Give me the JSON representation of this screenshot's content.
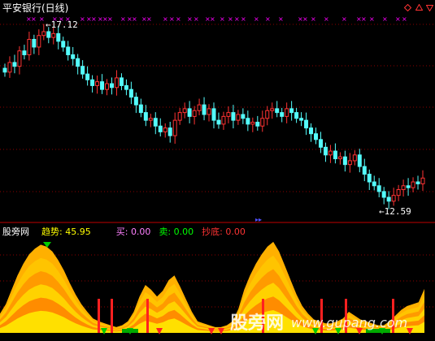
{
  "main_panel": {
    "title": "平安银行(日线)",
    "high_label": "17.12",
    "low_label": "12.59",
    "controls": [
      "diamond-icon",
      "up-arrow-icon",
      "down-arrow-icon"
    ]
  },
  "indicator_panel": {
    "name": "股旁网",
    "trend_label": "趋势:",
    "trend_value": "45.95",
    "buy_label": "买:",
    "buy_value": "0.00",
    "sell_label": "卖:",
    "sell_value": "0.00",
    "bottom_label": "抄底:",
    "bottom_value": "0.00"
  },
  "watermark": {
    "cn": "股旁网",
    "url": "www.gupang.com"
  },
  "colors": {
    "background": "#000000",
    "up": "#ff3333",
    "down": "#54fcfc",
    "marker": "#ff00ff",
    "grid": "#8b0000",
    "divider": "#c00000",
    "trend": "#ffff00",
    "buy": "#ff80ff",
    "sell": "#00ff00",
    "bottom": "#ff3333"
  },
  "chart_data": {
    "type": "candlestick",
    "title": "平安银行(日线)",
    "annotations": [
      "17.12",
      "12.59"
    ],
    "closes": [
      15.95,
      16.2,
      16.1,
      16.5,
      16.4,
      16.8,
      16.6,
      16.9,
      17.0,
      16.85,
      16.95,
      16.75,
      16.6,
      16.4,
      16.3,
      16.1,
      15.9,
      15.75,
      15.6,
      15.7,
      15.5,
      15.65,
      15.55,
      15.8,
      15.6,
      15.5,
      15.3,
      15.1,
      14.9,
      14.7,
      14.75,
      14.55,
      14.4,
      14.5,
      14.3,
      14.7,
      14.9,
      15.0,
      14.8,
      14.95,
      15.1,
      14.85,
      15.0,
      14.7,
      14.6,
      14.8,
      14.9,
      14.7,
      14.85,
      14.75,
      14.6,
      14.65,
      14.55,
      14.75,
      14.95,
      15.0,
      14.9,
      14.8,
      15.0,
      14.9,
      14.75,
      14.7,
      14.5,
      14.35,
      14.2,
      14.0,
      13.8,
      13.9,
      13.7,
      13.75,
      13.55,
      13.65,
      13.8,
      13.5,
      13.3,
      13.1,
      13.0,
      12.85,
      12.7,
      12.6,
      12.75,
      12.9,
      13.0,
      12.95,
      13.1,
      13.05,
      13.2
    ],
    "trend_values": [
      20,
      30,
      45,
      60,
      72,
      82,
      88,
      92,
      90,
      85,
      76,
      65,
      52,
      40,
      30,
      22,
      15,
      12,
      10,
      8,
      6,
      8,
      12,
      22,
      38,
      50,
      45,
      38,
      44,
      55,
      60,
      48,
      35,
      22,
      12,
      10,
      8,
      6,
      6,
      8,
      12,
      25,
      45,
      60,
      72,
      82,
      90,
      95,
      85,
      70,
      55,
      40,
      28,
      20,
      14,
      12,
      10,
      10,
      12,
      15,
      22,
      18,
      14,
      12,
      10,
      8,
      8,
      12,
      18,
      24,
      28,
      30,
      32,
      45.95
    ],
    "buy_signals": [
      1,
      1,
      1,
      1,
      0,
      0,
      0,
      0,
      0,
      0,
      0,
      0,
      0,
      1,
      0,
      0,
      0,
      0,
      0,
      0
    ],
    "trend_value": 45.95,
    "buy_value": 0.0,
    "sell_value": 0.0,
    "bottom_value": 0.0
  }
}
